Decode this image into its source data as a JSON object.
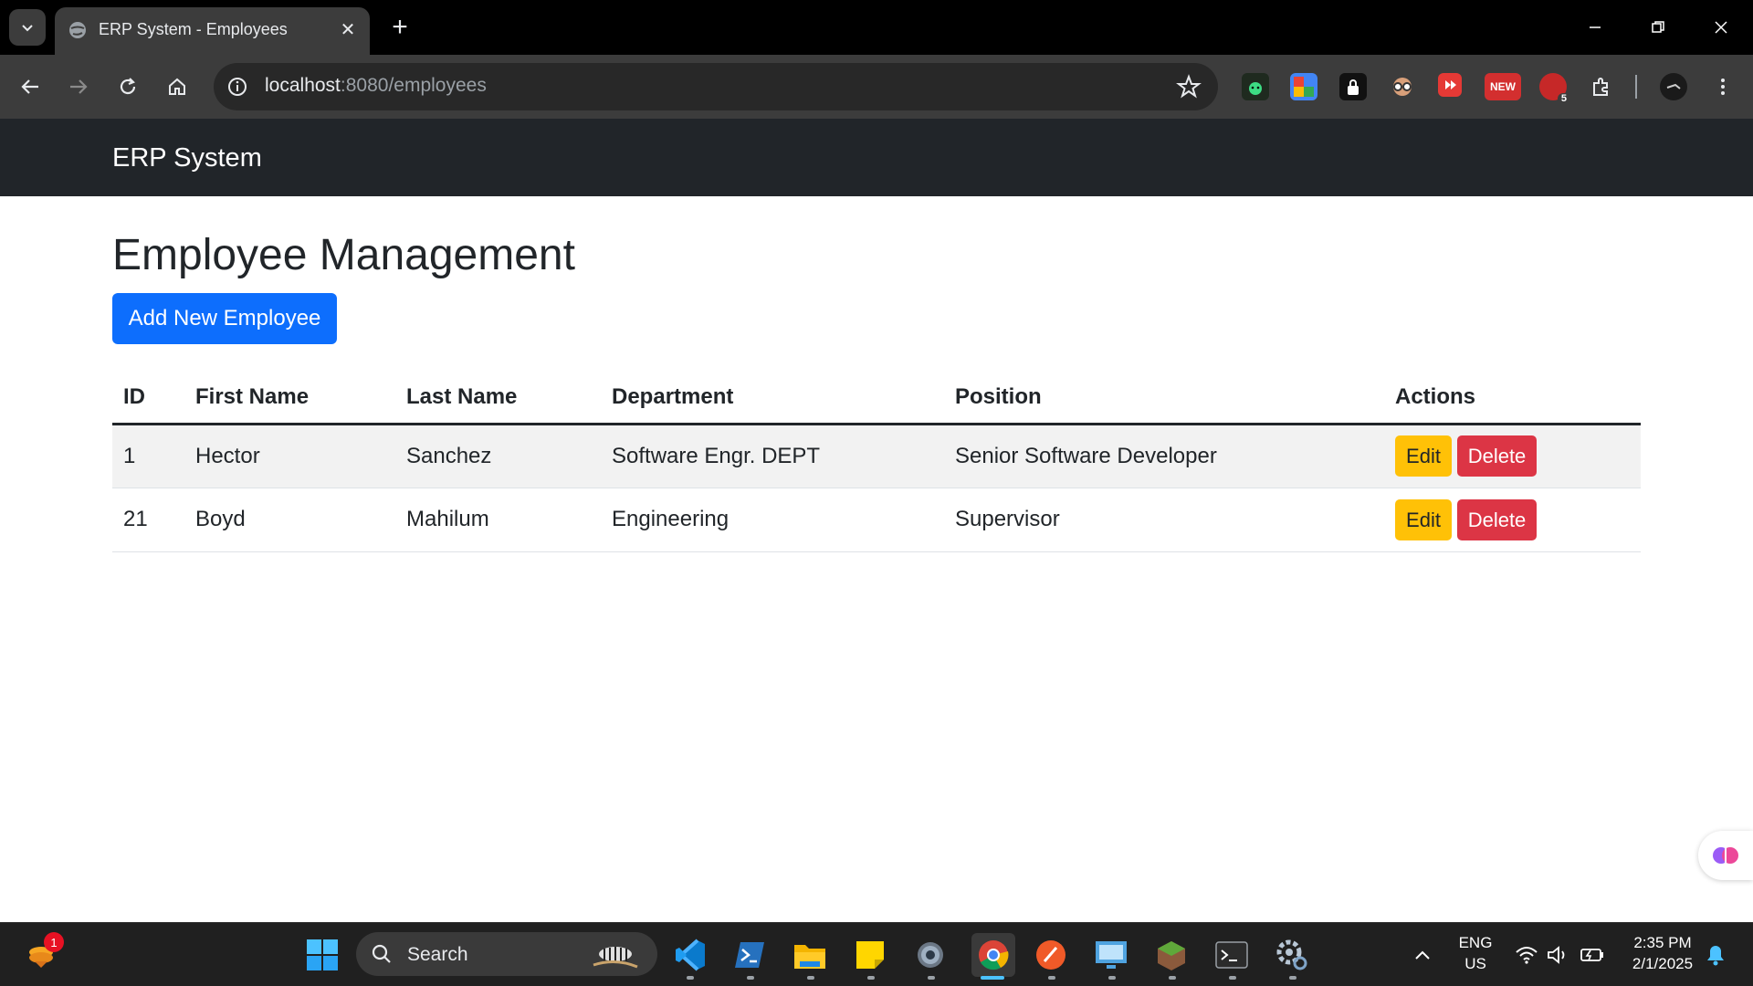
{
  "browser": {
    "tab_title": "ERP System - Employees",
    "url_host": "localhost",
    "url_rest": ":8080/employees",
    "icons": [
      "tab-search-icon",
      "globe-icon",
      "close-icon",
      "plus-icon",
      "minimize-icon",
      "restore-icon",
      "window-close-icon",
      "back-icon",
      "forward-icon",
      "reload-icon",
      "home-icon",
      "site-info-icon",
      "bookmark-star-icon",
      "extensions-icon",
      "profile-avatar-icon",
      "menu-icon"
    ],
    "extensions": [
      {
        "name": "android-ext-icon",
        "color": "#1f2a1f",
        "label": ""
      },
      {
        "name": "translate-ext-icon",
        "color": "#4285f4",
        "label": ""
      },
      {
        "name": "lock-ext-icon",
        "color": "#111111",
        "label": ""
      },
      {
        "name": "glasses-ext-icon",
        "color": "#6b4f3a",
        "label": ""
      },
      {
        "name": "media-ext-icon",
        "color": "#e53935",
        "label": ""
      },
      {
        "name": "new-ext-icon",
        "color": "#d32f2f",
        "label": "NEW"
      },
      {
        "name": "shield-ext-icon",
        "color": "#c62828",
        "label": "5"
      }
    ]
  },
  "navbar": {
    "brand": "ERP System"
  },
  "main": {
    "title": "Employee Management",
    "add_button": "Add New Employee",
    "table": {
      "headers": {
        "id": "ID",
        "first": "First Name",
        "last": "Last Name",
        "dept": "Department",
        "position": "Position",
        "actions": "Actions"
      },
      "rows": [
        {
          "id": "1",
          "first": "Hector",
          "last": "Sanchez",
          "dept": "Software Engr. DEPT",
          "position": "Senior Software Developer",
          "edit": "Edit",
          "delete": "Delete"
        },
        {
          "id": "21",
          "first": "Boyd",
          "last": "Mahilum",
          "dept": "Engineering",
          "position": "Supervisor",
          "edit": "Edit",
          "delete": "Delete"
        }
      ]
    }
  },
  "taskbar": {
    "search_label": "Search",
    "widget_badge": "1",
    "lang_top": "ENG",
    "lang_bottom": "US",
    "time": "2:35 PM",
    "date": "2/1/2025",
    "apps": [
      "windows-start-icon",
      "vscode-icon",
      "powershell-icon",
      "file-explorer-icon",
      "sticky-notes-icon",
      "settings-gear-icon",
      "chrome-icon",
      "paint-icon",
      "remote-desktop-icon",
      "minecraft-icon",
      "terminal-icon",
      "gear-app-icon"
    ]
  },
  "colors": {
    "primary": "#0d6efd",
    "warning": "#ffc107",
    "danger": "#dc3545",
    "navbar": "#212529"
  }
}
